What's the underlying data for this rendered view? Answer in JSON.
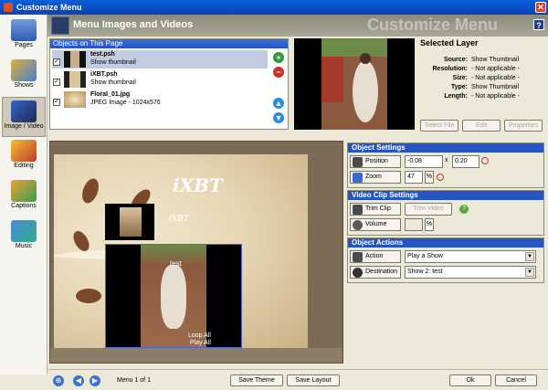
{
  "window": {
    "title": "Customize Menu"
  },
  "header": {
    "title": "Menu Images and Videos",
    "watermark": "Customize Menu",
    "help": "?"
  },
  "nav": [
    {
      "label": "Pages"
    },
    {
      "label": "Shows"
    },
    {
      "label": "Image / Video"
    },
    {
      "label": "Editing"
    },
    {
      "label": "Captions"
    },
    {
      "label": "Music"
    }
  ],
  "objects_panel": {
    "title": "Objects on This Page",
    "items": [
      {
        "name": "test.psh",
        "desc": "Show thumbnail"
      },
      {
        "name": "iXBT.psh",
        "desc": "Show thumbnail"
      },
      {
        "name": "Floral_01.jpg",
        "desc": "JPEG Image - 1024x576"
      }
    ]
  },
  "selected_layer": {
    "title": "Selected Layer",
    "rows": [
      {
        "key": "Source:",
        "value": "Show Thumbnail"
      },
      {
        "key": "Resolution:",
        "value": "- Not applicable -"
      },
      {
        "key": "Size:",
        "value": "- Not applicable -"
      },
      {
        "key": "Type:",
        "value": "Show Thumbnail"
      },
      {
        "key": "Length:",
        "value": "- Not applicable -"
      }
    ],
    "buttons": {
      "select_file": "Select File",
      "edit": "Edit",
      "properties": "Properties"
    }
  },
  "canvas": {
    "title_text": "iXBT",
    "thumb_text": "iXBT",
    "menu_item_a": "test",
    "menu_item_b": "Loop All",
    "menu_item_c": "Play All"
  },
  "object_settings": {
    "title": "Object Settings",
    "position_label": "Position",
    "position_x": "-0.08",
    "position_sep": "x",
    "position_y": "0.20",
    "zoom_label": "Zoom",
    "zoom_value": "47",
    "zoom_unit": "%"
  },
  "video_clip_settings": {
    "title": "Video Clip Settings",
    "trim_label": "Trim Clip",
    "trim_button": "Trim Video",
    "volume_label": "Volume",
    "volume_value": "",
    "volume_unit": "%"
  },
  "object_actions": {
    "title": "Object Actions",
    "action_label": "Action",
    "action_value": "Play a Show",
    "destination_label": "Destination",
    "destination_value": "Show 2: test"
  },
  "footer": {
    "menu_page": "Menu 1 of 1",
    "save_theme": "Save Theme",
    "save_layout": "Save Layout",
    "ok": "Ok",
    "cancel": "Cancel"
  }
}
